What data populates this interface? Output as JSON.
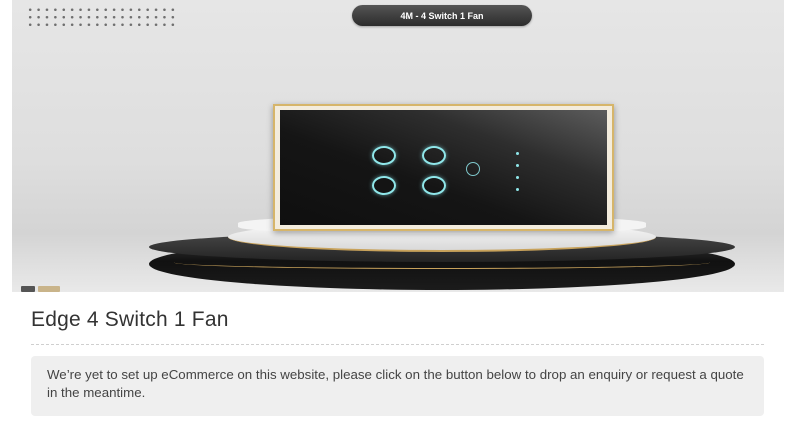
{
  "product": {
    "badge_label": "4M - 4 Switch 1 Fan",
    "title": "Edge 4 Switch 1 Fan"
  },
  "notice": {
    "message": "We’re yet to set up eCommerce on this website, please click on the button below to drop an enquiry or request a quote in the meantime."
  },
  "icons": {
    "fan_control": "fan-icon"
  },
  "colors": {
    "touch_ring": "#8fe7ea",
    "gold_trim": "#c8a25b",
    "badge_bg": "#3a3a3a",
    "notice_bg": "#efefef"
  }
}
